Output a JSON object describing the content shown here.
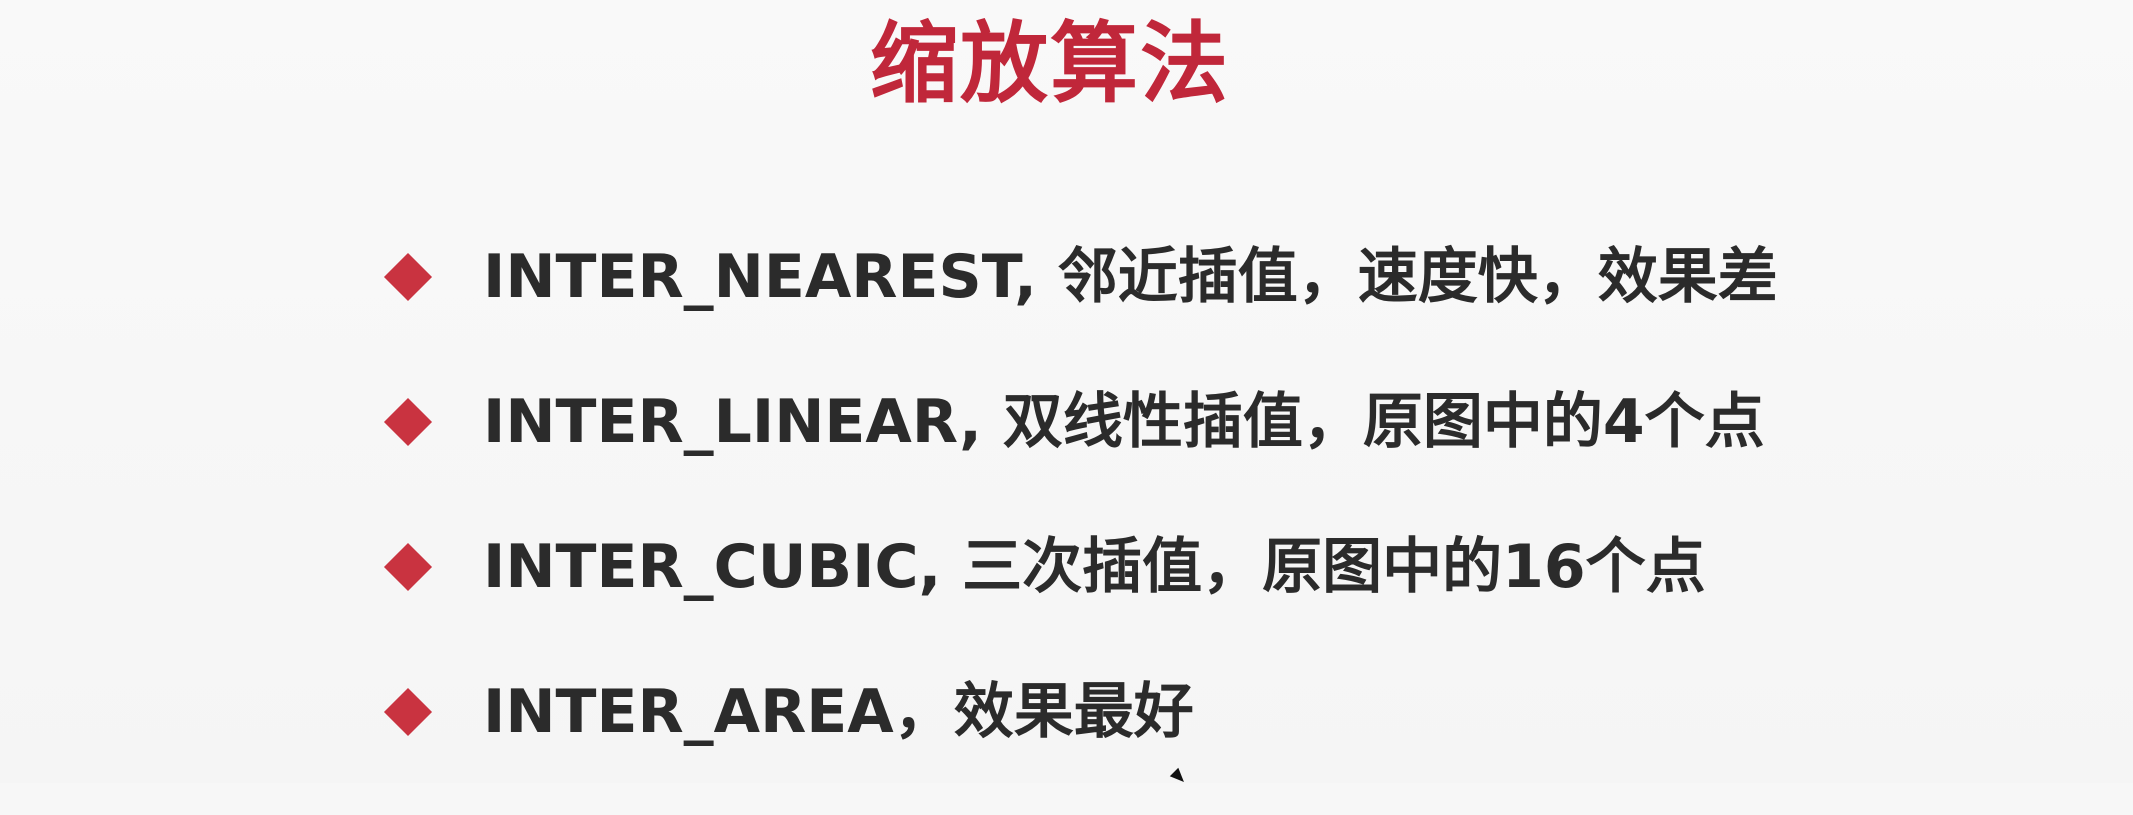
{
  "slide": {
    "title": "缩放算法",
    "bullets": [
      {
        "text": "INTER_NEAREST, 邻近插值，速度快，效果差"
      },
      {
        "text": "INTER_LINEAR, 双线性插值，原图中的4个点"
      },
      {
        "text": "INTER_CUBIC, 三次插值，原图中的16个点"
      },
      {
        "text": "INTER_AREA，效果最好"
      }
    ]
  },
  "colors": {
    "title": "#c0273a",
    "bullet_marker": "#c93340",
    "text": "#2b2b2b",
    "background": "#f7f7f7"
  },
  "icons": {
    "bullet_marker": "diamond-bullet-icon",
    "pointer": "mouse-pointer-icon"
  }
}
